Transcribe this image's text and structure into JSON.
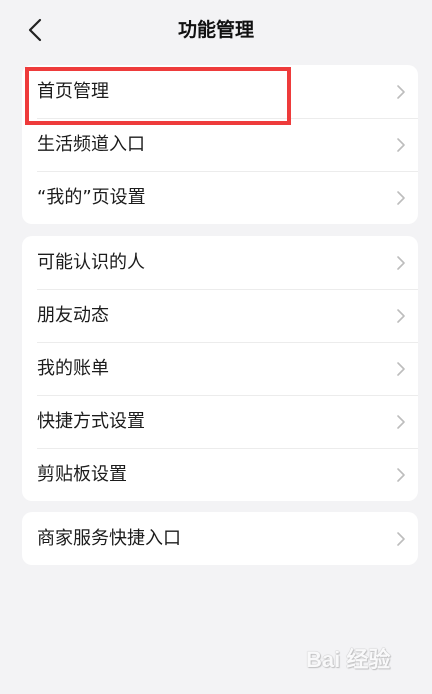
{
  "header": {
    "title": "功能管理",
    "back_icon": "chevron-left-icon"
  },
  "groups": [
    {
      "items": [
        {
          "label": "首页管理"
        },
        {
          "label": "生活频道入口"
        },
        {
          "label": "“我的”页设置"
        }
      ]
    },
    {
      "items": [
        {
          "label": "可能认识的人"
        },
        {
          "label": "朋友动态"
        },
        {
          "label": "我的账单"
        },
        {
          "label": "快捷方式设置"
        },
        {
          "label": "剪贴板设置"
        }
      ]
    },
    {
      "items": [
        {
          "label": "商家服务快捷入口"
        }
      ]
    }
  ],
  "annotation": {
    "highlight_color": "#ee3b3b"
  },
  "watermark": {
    "text": "Bai 经验"
  },
  "colors": {
    "background": "#f3f3f5",
    "card": "#ffffff",
    "chevron": "#bdbdbd"
  }
}
